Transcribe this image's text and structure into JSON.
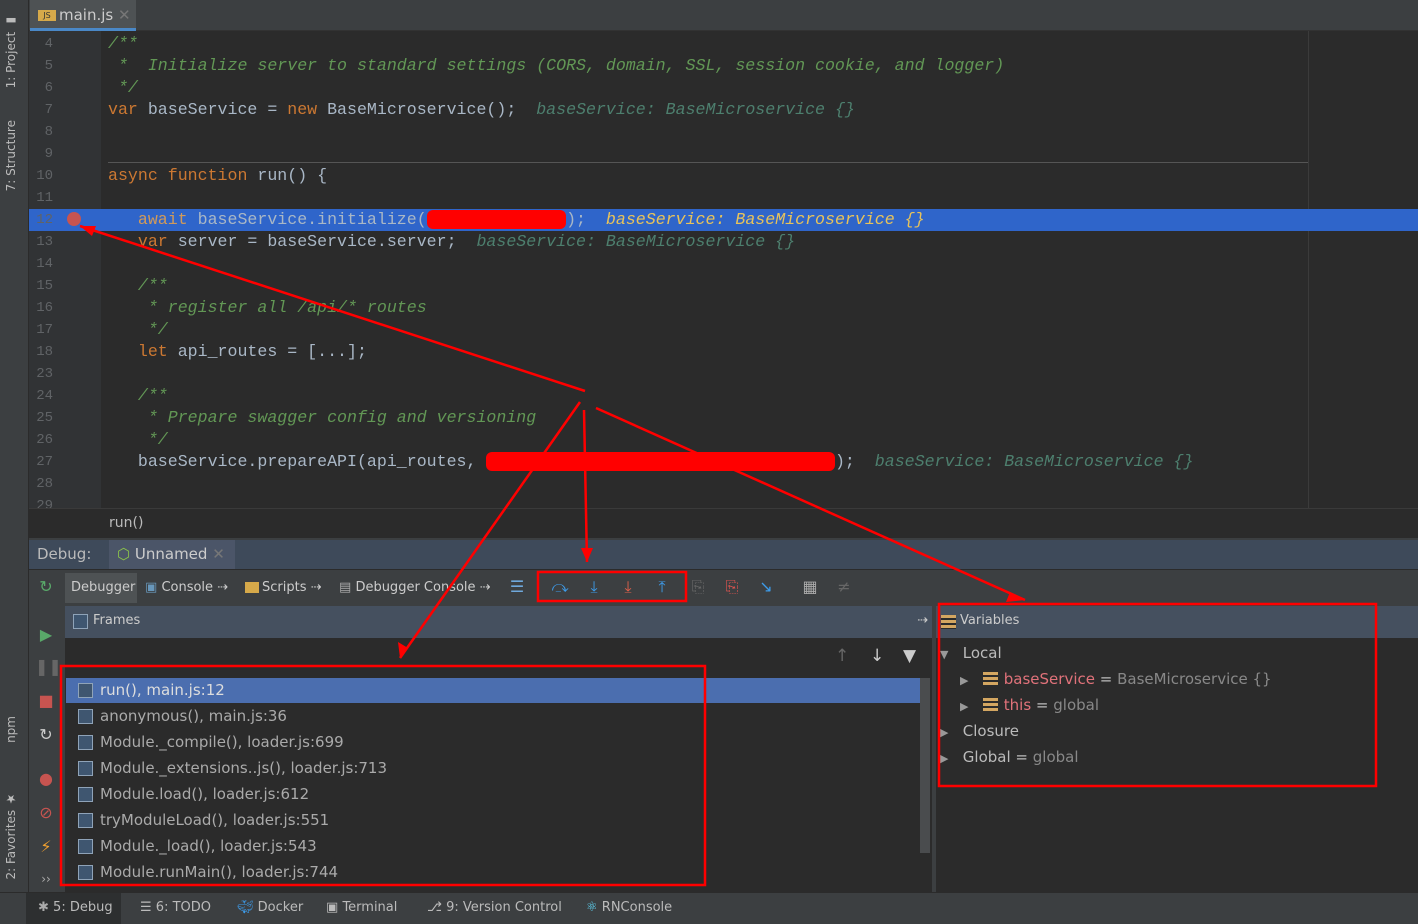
{
  "sidebar": {
    "project": "1: Project",
    "structure": "7: Structure",
    "npm": "npm",
    "favorites": "2: Favorites"
  },
  "editor": {
    "tab": "main.js",
    "tab_icon": "JS",
    "lines": [
      {
        "n": "4",
        "seg": [
          [
            "/**",
            "c"
          ]
        ]
      },
      {
        "n": "5",
        "seg": [
          [
            " *  Initialize server to standard settings (CORS, domain, SSL, session cookie, and logger)",
            "c"
          ]
        ]
      },
      {
        "n": "6",
        "seg": [
          [
            " */",
            "c"
          ]
        ]
      },
      {
        "n": "7",
        "seg": [
          [
            "var",
            "k"
          ],
          [
            " baseService = ",
            "t"
          ],
          [
            "new",
            "k"
          ],
          [
            " BaseMicroservice();",
            "t"
          ],
          [
            "  baseService: BaseMicroservice {}",
            "h"
          ]
        ]
      },
      {
        "n": "8",
        "seg": []
      },
      {
        "n": "9",
        "seg": []
      },
      {
        "n": "10",
        "seg": [
          [
            "async",
            "k"
          ],
          [
            " ",
            "t"
          ],
          [
            "function",
            "k"
          ],
          [
            " run() {",
            "t"
          ]
        ]
      },
      {
        "n": "11",
        "seg": []
      },
      {
        "n": "12",
        "sel": true,
        "seg": [
          [
            "   await",
            "k"
          ],
          [
            " baseService.initialize(",
            "t"
          ],
          [
            "              ",
            "r"
          ],
          [
            ");",
            "t"
          ],
          [
            "  baseService: BaseMicroservice {}",
            "h"
          ]
        ]
      },
      {
        "n": "13",
        "seg": [
          [
            "   var",
            "k"
          ],
          [
            " server = baseService.server;",
            "t"
          ],
          [
            "  baseService: BaseMicroservice {}",
            "h"
          ]
        ]
      },
      {
        "n": "14",
        "seg": []
      },
      {
        "n": "15",
        "seg": [
          [
            "   /**",
            "c"
          ]
        ]
      },
      {
        "n": "16",
        "seg": [
          [
            "    * register all /api/* routes",
            "c"
          ]
        ]
      },
      {
        "n": "17",
        "seg": [
          [
            "    */",
            "c"
          ]
        ]
      },
      {
        "n": "18",
        "seg": [
          [
            "   let",
            "k"
          ],
          [
            " api_routes = [...];",
            "t"
          ]
        ]
      },
      {
        "n": "23",
        "seg": []
      },
      {
        "n": "24",
        "seg": [
          [
            "   /**",
            "c"
          ]
        ]
      },
      {
        "n": "25",
        "seg": [
          [
            "    * Prepare swagger config and versioning",
            "c"
          ]
        ]
      },
      {
        "n": "26",
        "seg": [
          [
            "    */",
            "c"
          ]
        ]
      },
      {
        "n": "27",
        "seg": [
          [
            "   baseService.prepareAPI(api_routes, ",
            "t"
          ],
          [
            "                                   ",
            "r"
          ],
          [
            ");",
            "t"
          ],
          [
            "  baseService: BaseMicroservice {}",
            "h"
          ]
        ]
      },
      {
        "n": "28",
        "seg": []
      },
      {
        "n": "29",
        "seg": []
      }
    ],
    "breadcrumb": "run()"
  },
  "debug": {
    "label": "Debug:",
    "session": "Unnamed",
    "tabs": {
      "debugger": "Debugger",
      "console": "Console",
      "scripts": "Scripts",
      "debugger_console": "Debugger Console"
    },
    "frames": {
      "title": "Frames",
      "items": [
        "run(), main.js:12",
        "anonymous(), main.js:36",
        "Module._compile(), loader.js:699",
        "Module._extensions..js(), loader.js:713",
        "Module.load(), loader.js:612",
        "tryModuleLoad(), loader.js:551",
        "Module._load(), loader.js:543",
        "Module.runMain(), loader.js:744"
      ]
    },
    "variables": {
      "title": "Variables",
      "local": "Local",
      "closure": "Closure",
      "global": "Global",
      "global_value": "global",
      "items": [
        {
          "name": "baseService",
          "value": "BaseMicroservice {}"
        },
        {
          "name": "this",
          "value": "global"
        }
      ]
    }
  },
  "statusbar": {
    "debug": "5: Debug",
    "todo": "6: TODO",
    "docker": "Docker",
    "terminal": "Terminal",
    "vcs": "9: Version Control",
    "rnconsole": "RNConsole"
  },
  "colors": {
    "annotation": "#ff0000",
    "selection": "#2f65ca",
    "keyword": "#cc7832"
  }
}
